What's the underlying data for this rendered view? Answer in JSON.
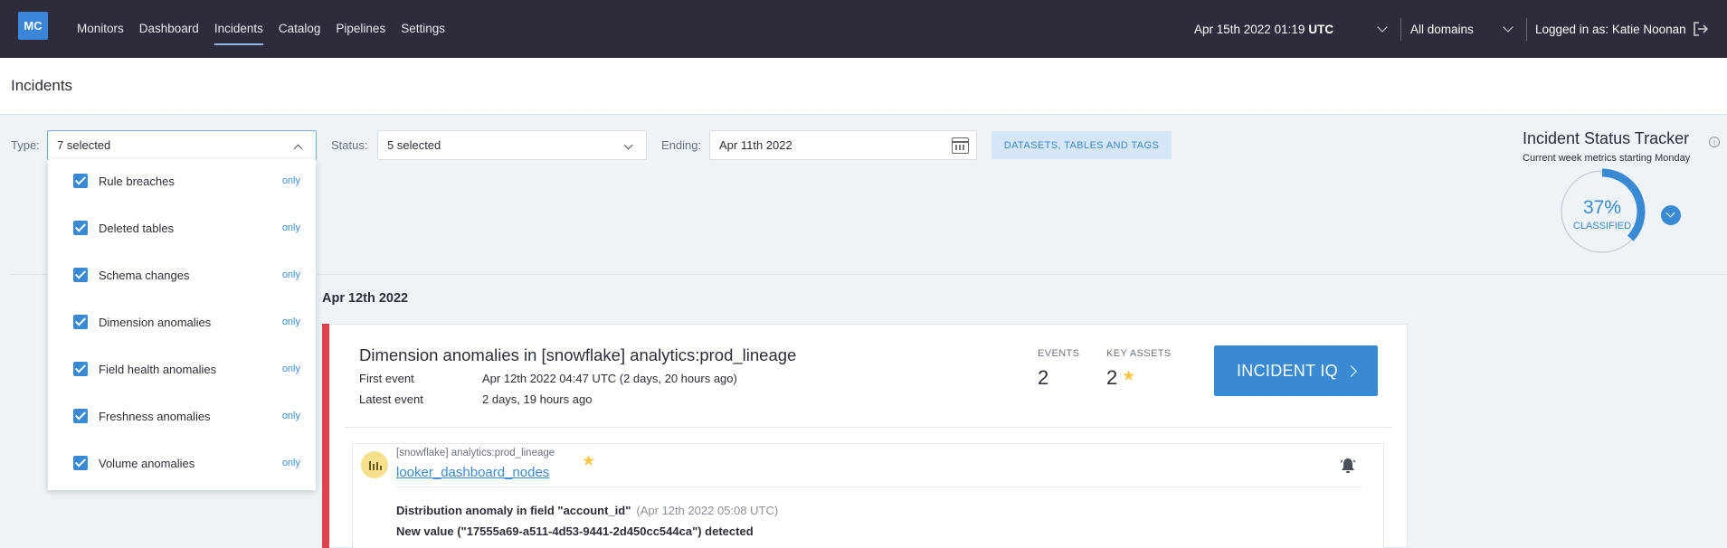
{
  "nav": {
    "logo": "MC",
    "items": [
      {
        "label": "Monitors"
      },
      {
        "label": "Dashboard"
      },
      {
        "label": "Incidents"
      },
      {
        "label": "Catalog"
      },
      {
        "label": "Pipelines"
      },
      {
        "label": "Settings"
      }
    ],
    "active": "Incidents",
    "datetime": "Apr 15th 2022 01:19",
    "timezone": "UTC",
    "domain_select": "All domains",
    "logged_in": "Logged in as: Katie Noonan"
  },
  "page": {
    "title": "Incidents"
  },
  "filters": {
    "type_label": "Type:",
    "type_value": "7 selected",
    "status_label": "Status:",
    "status_value": "5 selected",
    "ending_label": "Ending:",
    "ending_value": "Apr 11th 2022",
    "datasets_button": "DATASETS, TABLES AND TAGS"
  },
  "type_dropdown": {
    "only_label": "only",
    "options": [
      {
        "label": "Rule breaches",
        "checked": true
      },
      {
        "label": "Deleted tables",
        "checked": true
      },
      {
        "label": "Schema changes",
        "checked": true
      },
      {
        "label": "Dimension anomalies",
        "checked": true
      },
      {
        "label": "Field health anomalies",
        "checked": true
      },
      {
        "label": "Freshness anomalies",
        "checked": true
      },
      {
        "label": "Volume anomalies",
        "checked": true
      }
    ]
  },
  "tracker": {
    "title": "Incident Status Tracker",
    "subtitle": "Current week metrics starting Monday",
    "percent_label": "37%",
    "percent_value": 0.37,
    "classified_label": "CLASSIFIED"
  },
  "incidents": {
    "date": "Apr 12th 2022",
    "card": {
      "title": "Dimension anomalies in [snowflake] analytics:prod_lineage",
      "first_event_label": "First event",
      "first_event_value": "Apr 12th 2022 04:47 UTC (2 days, 20 hours ago)",
      "latest_event_label": "Latest event",
      "latest_event_value": "2 days, 19 hours ago",
      "events_label": "EVENTS",
      "events_value": "2",
      "key_assets_label": "KEY ASSETS",
      "key_assets_value": "2",
      "iq_button": "INCIDENT IQ",
      "event": {
        "asset_path": "[snowflake] analytics:prod_lineage",
        "asset_name": "looker_dashboard_nodes",
        "line1": "Distribution anomaly in field \"account_id\"",
        "line1_time": "(Apr 12th 2022 05:08 UTC)",
        "line2": "New value (\"17555a69-a511-4d53-9441-2d450cc544ca\") detected"
      }
    }
  },
  "colors": {
    "topbar": "#2e2b3d",
    "accent": "#3a8ad3",
    "severity": "#d9454c",
    "star": "#f3c64a"
  }
}
